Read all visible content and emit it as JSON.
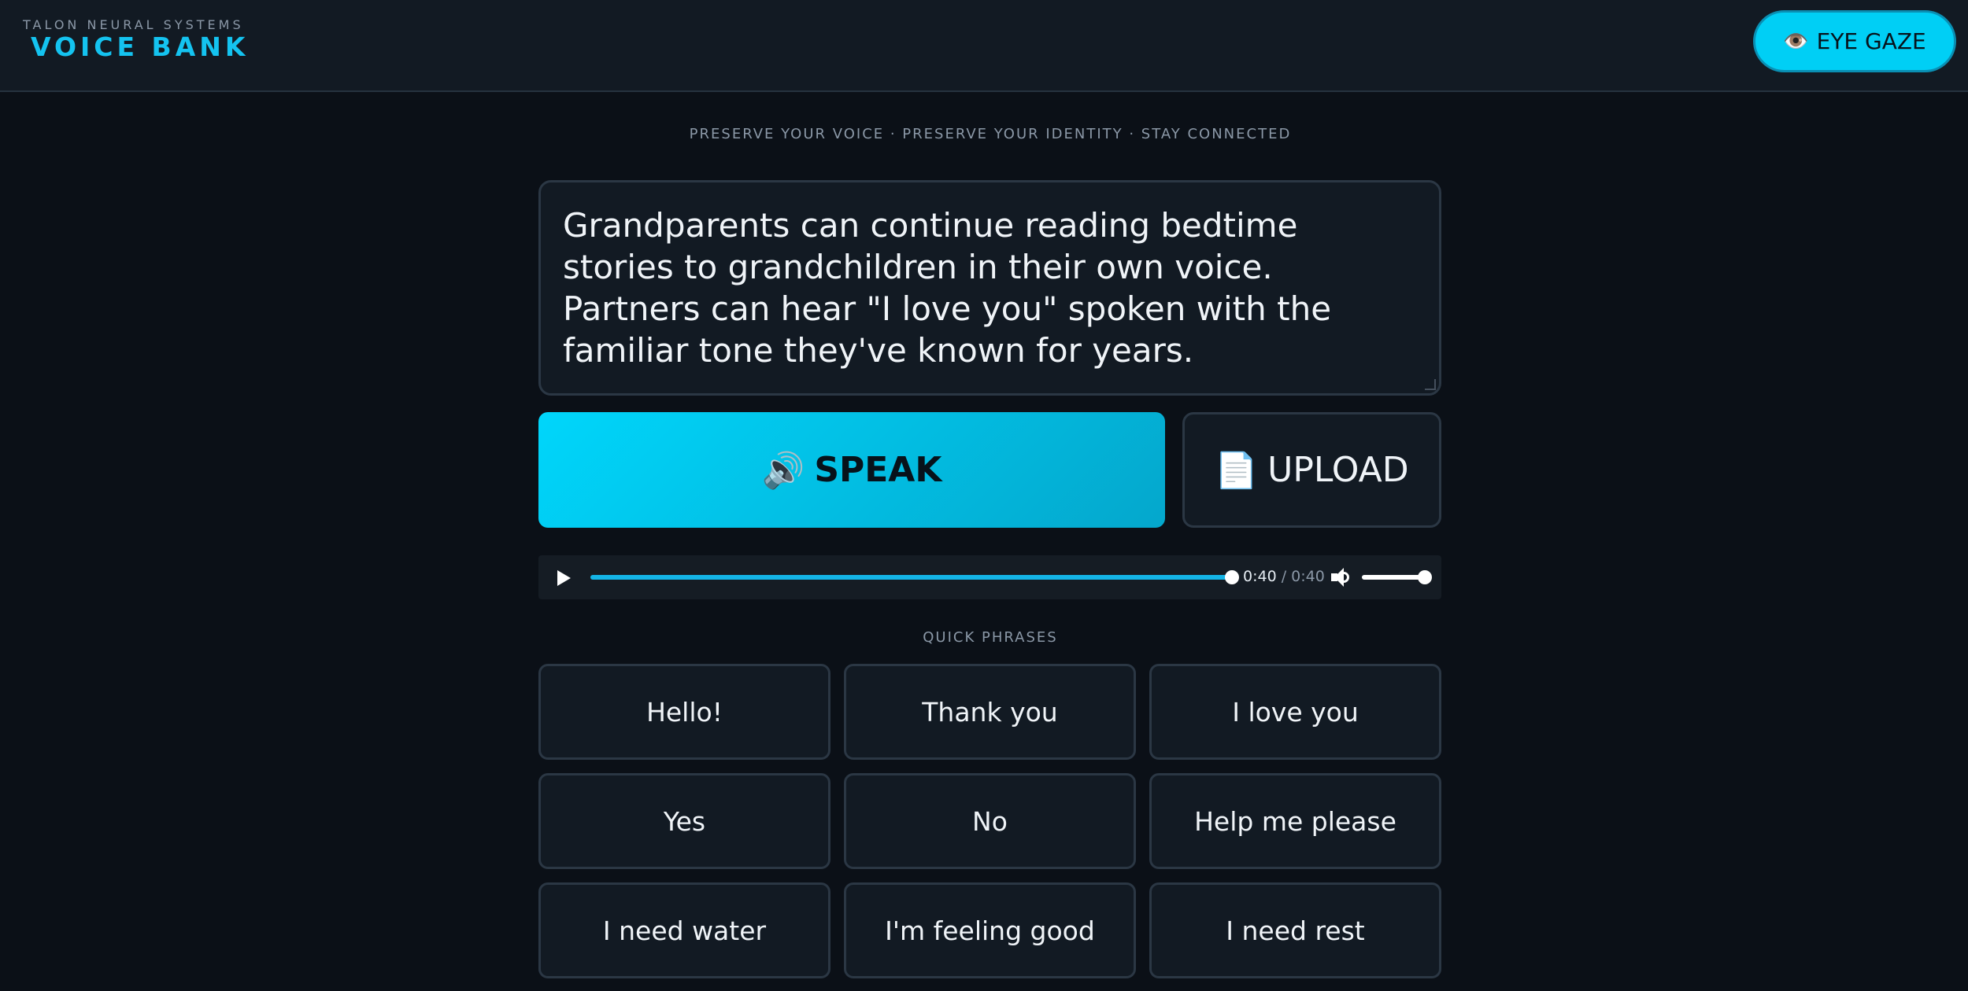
{
  "header": {
    "company": "TALON NEURAL SYSTEMS",
    "title": "VOICE BANK",
    "eye_gaze": {
      "icon": "eye-icon",
      "glyph": "👁️",
      "label": "EYE GAZE"
    }
  },
  "tagline": "PRESERVE YOUR VOICE · PRESERVE YOUR IDENTITY · STAY CONNECTED",
  "text_input": {
    "value": "Grandparents can continue reading bedtime stories to grandchildren in their own voice. Partners can hear \"I love you\" spoken with the familiar tone they've known for years."
  },
  "actions": {
    "speak": {
      "icon": "speaker-icon",
      "glyph": "🔊",
      "label": "SPEAK"
    },
    "upload": {
      "icon": "document-icon",
      "glyph": "📄",
      "label": "UPLOAD"
    }
  },
  "audio_player": {
    "current_time": "0:40",
    "separator": " / ",
    "duration": "0:40",
    "progress": 1.0,
    "volume": 1.0
  },
  "quick_phrases": {
    "heading": "QUICK PHRASES",
    "items": [
      "Hello!",
      "Thank you",
      "I love you",
      "Yes",
      "No",
      "Help me please",
      "I need water",
      "I'm feeling good",
      "I need rest"
    ]
  },
  "colors": {
    "background": "#0b1017",
    "accent": "#00cff5",
    "brand_text": "#14c3f0",
    "panel": "#121a23",
    "border": "#2b3744"
  }
}
